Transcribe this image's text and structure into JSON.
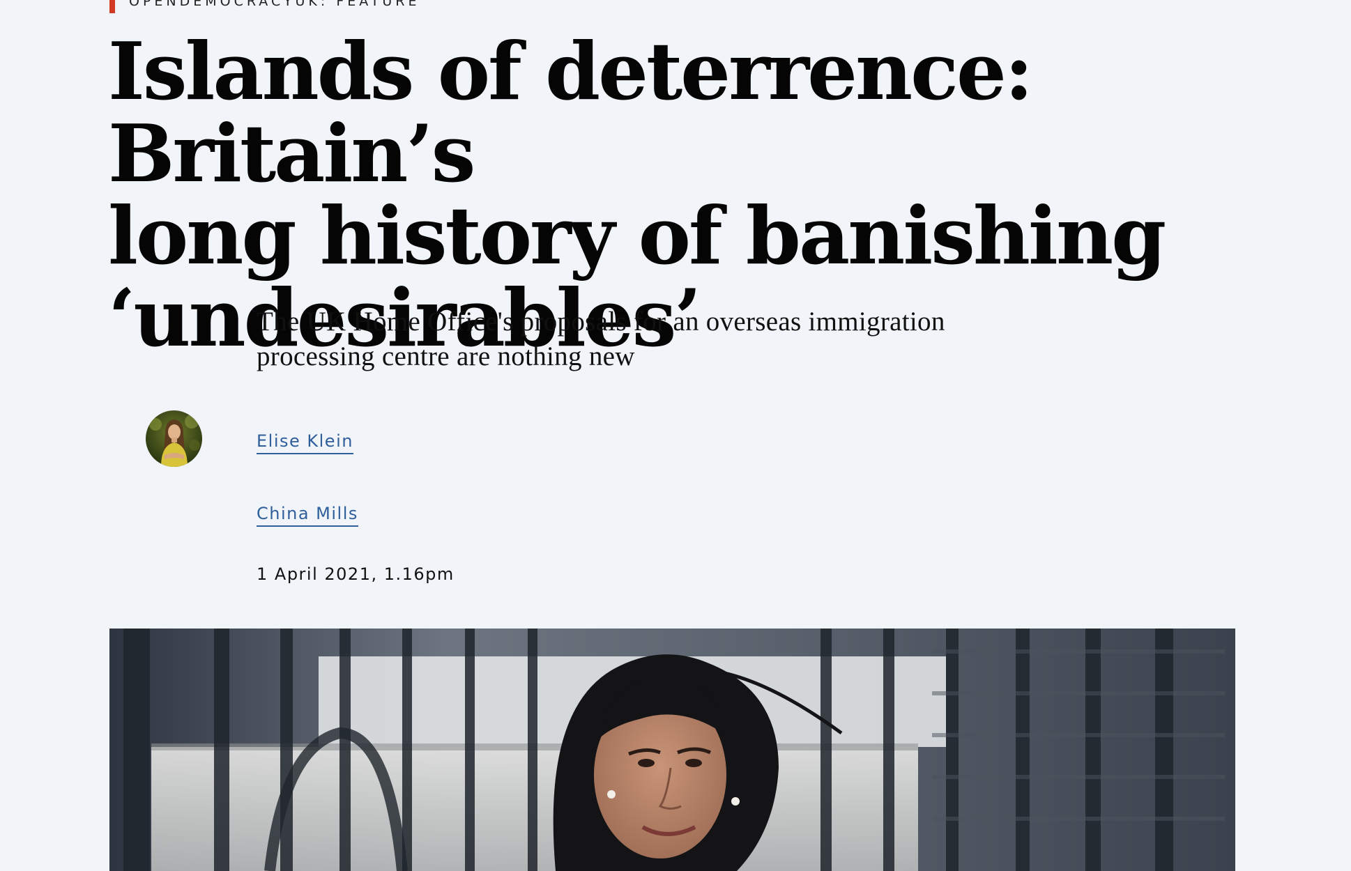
{
  "article": {
    "kicker": "OPENDEMOCRACYUK: FEATURE",
    "headline_lines": [
      "Islands of deterrence: Britain’s",
      "long history of banishing",
      "‘undesirables’"
    ],
    "standfirst_lines": [
      "The UK Home Office's proposals for an overseas immigration",
      "processing centre are nothing new"
    ],
    "authors": [
      {
        "name": "Elise Klein"
      },
      {
        "name": "China Mills"
      }
    ],
    "published": "1 April 2021, 1.16pm"
  },
  "colors": {
    "background": "#f1f5fa",
    "kicker_accent": "#d23a23",
    "link": "#2f5e9b",
    "text": "#0b0b0b"
  }
}
